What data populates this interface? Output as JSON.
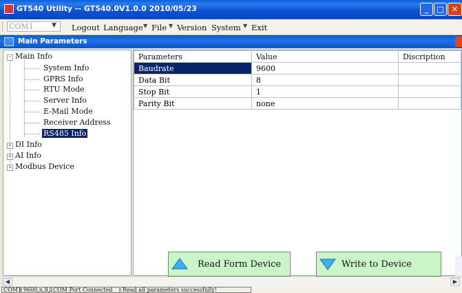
{
  "window": {
    "title": "GT540 Utility -- GT540.0V1.0.0 2010/05/23"
  },
  "menubar": {
    "port_value": "COM1",
    "items": [
      "Logout",
      "Language",
      "File",
      "Version",
      "System",
      "Exit"
    ]
  },
  "child_window": {
    "title": "Main Parameters"
  },
  "tree": {
    "main_info": "Main Info",
    "children": [
      "System Info",
      "GPRS Info",
      "RTU Mode",
      "Server Info",
      "E-Mail Mode",
      "Receiver Address",
      "RS485 Info"
    ],
    "selected": "RS485 Info",
    "others": [
      "DI Info",
      "AI Info",
      "Modbus Device"
    ]
  },
  "grid": {
    "headers": [
      "Parameters",
      "Value",
      "Discription"
    ],
    "rows": [
      {
        "param": "Baudrate",
        "value": "9600",
        "desc": ""
      },
      {
        "param": "Data Bit",
        "value": "8",
        "desc": ""
      },
      {
        "param": "Stop Bit",
        "value": "1",
        "desc": ""
      },
      {
        "param": "Parity Bit",
        "value": "none",
        "desc": ""
      }
    ]
  },
  "buttons": {
    "read": "Read Form Device",
    "write": "Write to Device"
  },
  "statusbar": {
    "port": "COM1",
    "setting": "9600,n,8,1",
    "connection": "COM Port Connected",
    "message": "Read all parameters successfully!"
  },
  "colors": {
    "title_blue": "#0a52d4",
    "selection": "#0a246a",
    "button_green": "#c9f5c9"
  }
}
